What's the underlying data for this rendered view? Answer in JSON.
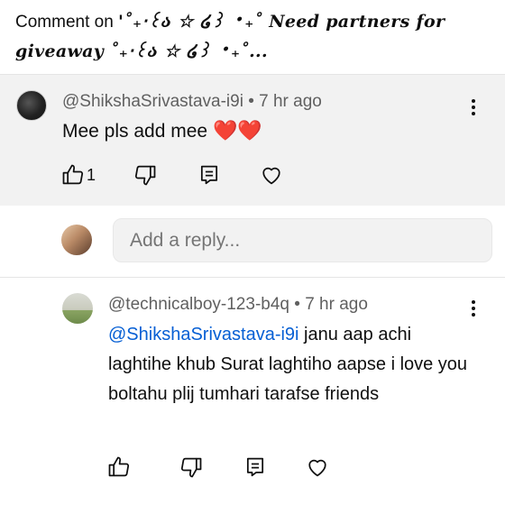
{
  "header": {
    "prefix": "Comment on ",
    "video_title": "'˚₊‧꒰ა ☆ ໒꒱ ‧₊˚ Need partners for giveaway ˚₊‧꒰ა ☆ ໒꒱ ‧₊˚..."
  },
  "comment": {
    "author": "@ShikshaSrivastava-i9i",
    "separator": " • ",
    "time": "7 hr ago",
    "text": "Mee pls add mee ",
    "hearts": "❤️❤️",
    "like_count": "1"
  },
  "reply_box": {
    "placeholder": "Add a reply..."
  },
  "reply": {
    "author": "@technicalboy-123-b4q",
    "separator": " • ",
    "time": "7 hr ago",
    "mention": "@ShikshaSrivastava-i9i",
    "text": " janu aap achi laghtihe khub Surat laghtiho aapse i love you boltahu plij tumhari tarafse friends"
  },
  "icons": {
    "like": "thumbs-up-icon",
    "dislike": "thumbs-down-icon",
    "reply": "reply-icon",
    "heart": "heart-icon",
    "menu": "more-vert-icon"
  },
  "colors": {
    "mention": "#065fd4",
    "heart": "#e0152a",
    "comment_bg": "#f2f2f2"
  }
}
